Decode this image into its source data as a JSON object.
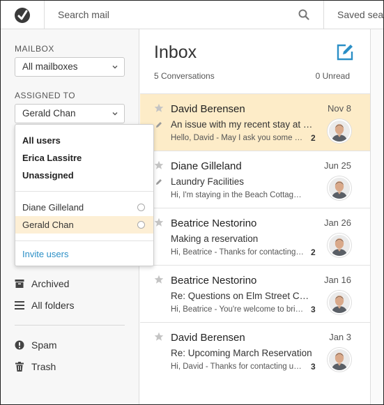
{
  "topbar": {
    "search_placeholder": "Search mail",
    "saved_label": "Saved searches"
  },
  "sidebar": {
    "mailbox_label": "MAILBOX",
    "mailbox_value": "All mailboxes",
    "assigned_label": "ASSIGNED TO",
    "assigned_value": "Gerald Chan",
    "dropdown": {
      "group_options": [
        "All users",
        "Erica Lassitre",
        "Unassigned"
      ],
      "user_options": [
        "Diane Gilleland",
        "Gerald Chan"
      ],
      "selected": "Gerald Chan",
      "invite_label": "Invite users"
    },
    "nav": {
      "archived": "Archived",
      "all_folders": "All folders",
      "spam": "Spam",
      "trash": "Trash"
    }
  },
  "inbox": {
    "title": "Inbox",
    "conversations_count": "5 Conversations",
    "unread_count": "0 Unread",
    "conversations": [
      {
        "name": "David Berensen",
        "date": "Nov 8",
        "subject": "An issue with my recent stay at Lake Cottage",
        "preview": "Hello, David - May I ask you some questions about",
        "count": "2",
        "active": true,
        "draft": true
      },
      {
        "name": "Diane Gilleland",
        "date": "Jun 25",
        "subject": "Laundry Facilities",
        "preview": "Hi, I'm staying in the Beach Cottage on the north shore",
        "count": "",
        "active": false,
        "draft": true
      },
      {
        "name": "Beatrice Nestorino",
        "date": "Jan 26",
        "subject": "Making a reservation",
        "preview": "Hi, Beatrice - Thanks for contacting us about",
        "count": "2",
        "active": false,
        "draft": false
      },
      {
        "name": "Beatrice Nestorino",
        "date": "Jan 16",
        "subject": "Re: Questions on Elm Street Cottage",
        "preview": "Hi, Beatrice - You're welcome to bring your dog",
        "count": "3",
        "active": false,
        "draft": false
      },
      {
        "name": "David Berensen",
        "date": "Jan 3",
        "subject": "Re: Upcoming March Reservation",
        "preview": "Hi, David - Thanks for contacting us again",
        "count": "3",
        "active": false,
        "draft": false
      }
    ]
  },
  "colors": {
    "accent": "#2b8fc6",
    "active_row": "#fdecc8",
    "selected_option": "#fdefd5"
  },
  "icons": [
    "logo-icon",
    "search-icon",
    "chevron-down-icon",
    "archive-icon",
    "folders-icon",
    "spam-icon",
    "trash-icon",
    "compose-icon",
    "star-icon",
    "pencil-icon"
  ]
}
